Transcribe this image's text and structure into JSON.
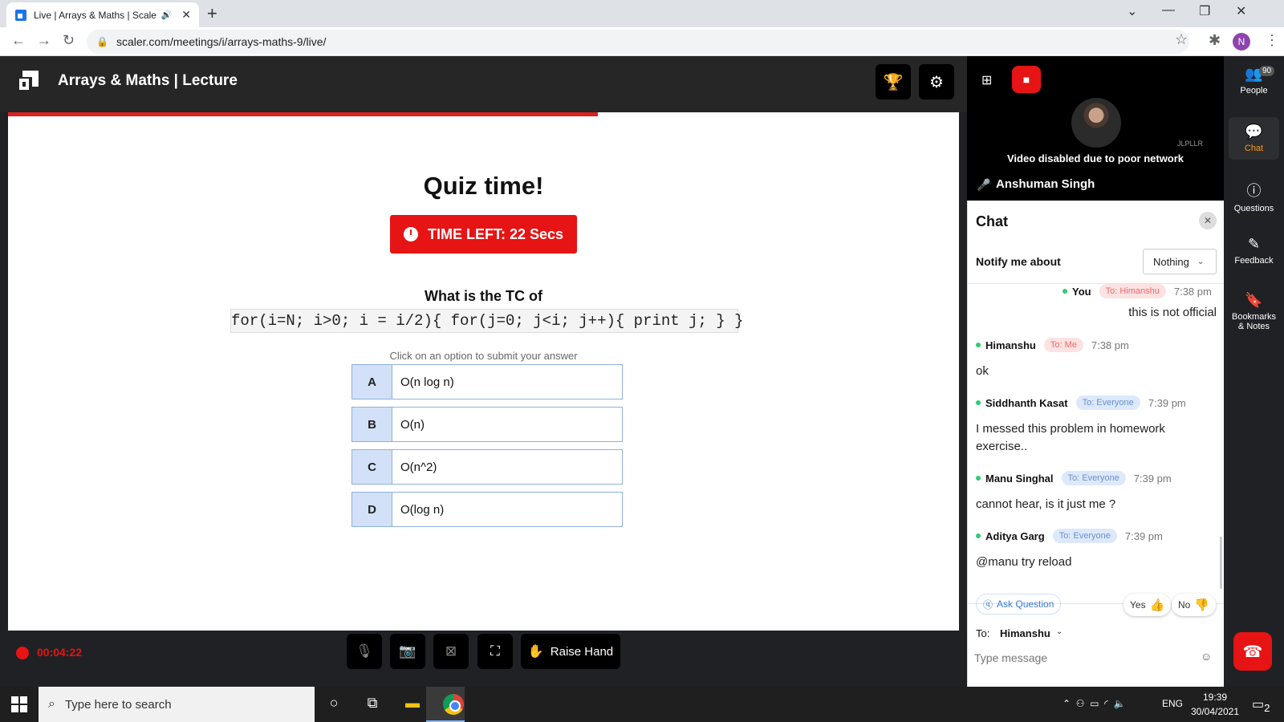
{
  "browser": {
    "tab_title": "Live | Arrays & Maths | Scaler",
    "url": "scaler.com/meetings/i/arrays-maths-9/live/",
    "profile_initial": "N"
  },
  "header": {
    "title": "Arrays & Maths | Lecture"
  },
  "quiz": {
    "progress_fraction": 0.62,
    "title": "Quiz time!",
    "timer": "TIME LEFT: 22 Secs",
    "question": "What is the TC of",
    "code": "for(i=N; i>0; i = i/2){ for(j=0; j<i; j++){ print j; } }",
    "hint": "Click on an option to submit your answer",
    "options": [
      {
        "letter": "A",
        "text": "O(n log n)"
      },
      {
        "letter": "B",
        "text": "O(n)"
      },
      {
        "letter": "C",
        "text": "O(n^2)"
      },
      {
        "letter": "D",
        "text": "O(log n)"
      }
    ]
  },
  "controls": {
    "recording_time": "00:04:22",
    "raise_hand": "Raise Hand"
  },
  "video": {
    "watermark": "JLPLLR",
    "message": "Video disabled due to poor network",
    "speaker": "Anshuman Singh"
  },
  "chat": {
    "title": "Chat",
    "notify_label": "Notify me about",
    "notify_value": "Nothing",
    "messages": [
      {
        "name": "You",
        "to": "To: Himanshu",
        "time": "7:38 pm",
        "text": "this is not official"
      },
      {
        "name": "Himanshu",
        "to": "To: Me",
        "time": "7:38 pm",
        "text": "ok"
      },
      {
        "name": "Siddhanth Kasat",
        "to": "To: Everyone",
        "time": "7:39 pm",
        "text": "I messed this problem in homework exercise.."
      },
      {
        "name": "Manu Singhal",
        "to": "To: Everyone",
        "time": "7:39 pm",
        "text": "cannot hear, is it just me ?"
      },
      {
        "name": "Aditya Garg",
        "to": "To: Everyone",
        "time": "7:39 pm",
        "text": "@manu try reload"
      }
    ],
    "ask_question": "Ask Question",
    "yes": "Yes",
    "no": "No",
    "to_label": "To:",
    "to_recipient": "Himanshu",
    "input_placeholder": "Type message"
  },
  "rail": {
    "people": "People",
    "people_count": "90",
    "chat": "Chat",
    "questions": "Questions",
    "feedback": "Feedback",
    "bookmarks": "Bookmarks & Notes"
  },
  "taskbar": {
    "search_placeholder": "Type here to search",
    "lang": "ENG",
    "time": "19:39",
    "date": "30/04/2021",
    "notification_count": "2"
  },
  "colors": {
    "accent_red": "#e61414",
    "option_blue": "#d2e1f7",
    "active_orange": "#f39c12"
  }
}
